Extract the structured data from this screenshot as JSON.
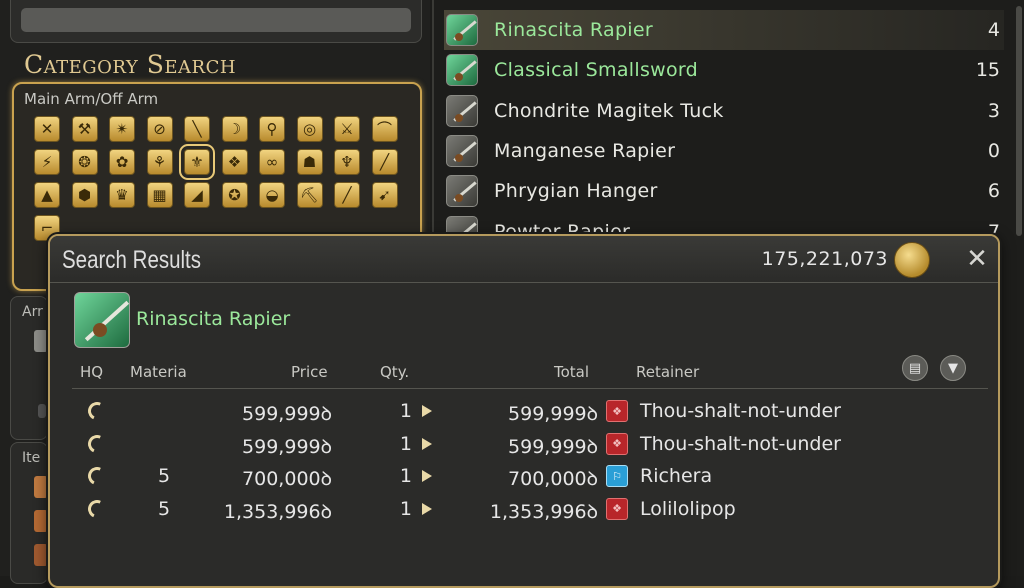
{
  "category_search": {
    "heading": "Category Search",
    "box_label": "Main Arm/Off Arm",
    "icons": [
      {
        "name": "pugilist-icon",
        "glyph": "✕"
      },
      {
        "name": "gladiator-icon",
        "glyph": "⚒"
      },
      {
        "name": "marauder-icon",
        "glyph": "✴"
      },
      {
        "name": "archer-icon",
        "glyph": "⊘"
      },
      {
        "name": "lancer-icon",
        "glyph": "╲"
      },
      {
        "name": "thaumaturge-icon",
        "glyph": "☽"
      },
      {
        "name": "conjurer-icon",
        "glyph": "⚲"
      },
      {
        "name": "arcanist-icon",
        "glyph": "◎"
      },
      {
        "name": "rogue-icon",
        "glyph": "⚔"
      },
      {
        "name": "machinist-icon",
        "glyph": "⌒"
      },
      {
        "name": "dark-knight-icon",
        "glyph": "⚡"
      },
      {
        "name": "astrologian-icon",
        "glyph": "❂"
      },
      {
        "name": "samurai-icon",
        "glyph": "✿"
      },
      {
        "name": "red-mage-icon",
        "glyph": "⚘"
      },
      {
        "name": "rapier-icon",
        "glyph": "⚜"
      },
      {
        "name": "gunbreaker-icon",
        "glyph": "❖"
      },
      {
        "name": "dancer-icon",
        "glyph": "∞"
      },
      {
        "name": "reaper-icon",
        "glyph": "☗"
      },
      {
        "name": "sage-icon",
        "glyph": "♆"
      },
      {
        "name": "carpenter-icon",
        "glyph": "╱"
      },
      {
        "name": "blacksmith-icon",
        "glyph": "▲"
      },
      {
        "name": "armorer-icon",
        "glyph": "⬢"
      },
      {
        "name": "goldsmith-icon",
        "glyph": "♛"
      },
      {
        "name": "leatherworker-icon",
        "glyph": "▦"
      },
      {
        "name": "weaver-icon",
        "glyph": "◢"
      },
      {
        "name": "alchemist-icon",
        "glyph": "✪"
      },
      {
        "name": "culinarian-icon",
        "glyph": "◒"
      },
      {
        "name": "miner-icon",
        "glyph": "⛏"
      },
      {
        "name": "botanist-icon",
        "glyph": "╱"
      },
      {
        "name": "fisher-icon",
        "glyph": "➹"
      },
      {
        "name": "scythe-icon",
        "glyph": "⌐"
      }
    ],
    "side_labels": [
      "Arr",
      "Ite"
    ]
  },
  "item_list": [
    {
      "name": "Rinascita Rapier",
      "count": "4",
      "selected": true,
      "green": true
    },
    {
      "name": "Classical Smallsword",
      "count": "15",
      "selected": false,
      "green": true
    },
    {
      "name": "Chondrite Magitek Tuck",
      "count": "3",
      "selected": false,
      "green": false
    },
    {
      "name": "Manganese Rapier",
      "count": "0",
      "selected": false,
      "green": false
    },
    {
      "name": "Phrygian Hanger",
      "count": "6",
      "selected": false,
      "green": false
    },
    {
      "name": "Pewter Rapier",
      "count": "7",
      "selected": false,
      "green": false
    }
  ],
  "search_results": {
    "title": "Search Results",
    "gil": "175,221,073",
    "item_name": "Rinascita Rapier",
    "columns": {
      "hq": "HQ",
      "materia": "Materia",
      "price": "Price",
      "qty": "Qty.",
      "total": "Total",
      "retainer": "Retainer"
    },
    "listings": [
      {
        "materia": "",
        "price": "599,999ꝺ",
        "qty": "1",
        "total": "599,999ꝺ",
        "retainer": "Thou-shalt-not-under",
        "retainer_color": "red"
      },
      {
        "materia": "",
        "price": "599,999ꝺ",
        "qty": "1",
        "total": "599,999ꝺ",
        "retainer": "Thou-shalt-not-under",
        "retainer_color": "red"
      },
      {
        "materia": "5",
        "price": "700,000ꝺ",
        "qty": "1",
        "total": "700,000ꝺ",
        "retainer": "Richera",
        "retainer_color": "blue"
      },
      {
        "materia": "5",
        "price": "1,353,996ꝺ",
        "qty": "1",
        "total": "1,353,996ꝺ",
        "retainer": "Lolilolipop",
        "retainer_color": "red"
      }
    ]
  },
  "colors": {
    "accent_gold": "#c9a24f",
    "hq_green": "#9be89b",
    "retainer_red": "#b8262a",
    "retainer_blue": "#2a9fd6"
  }
}
